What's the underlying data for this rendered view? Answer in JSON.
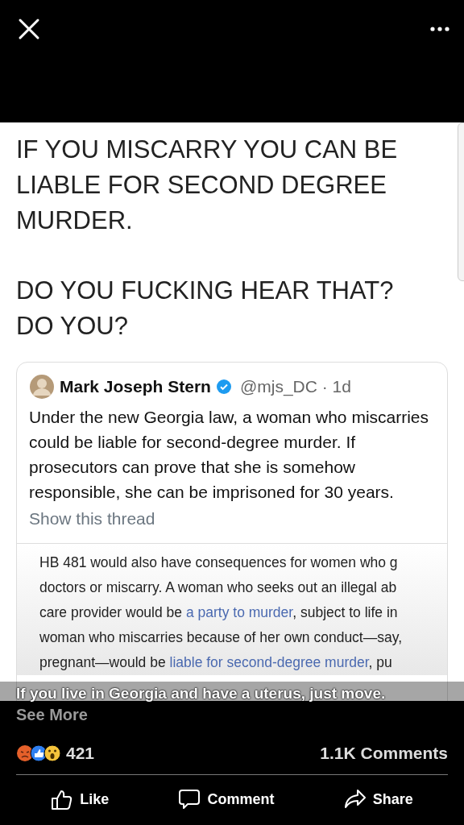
{
  "post_image": {
    "headline_lines": [
      "IF YOU MISCARRY YOU CAN BE",
      "LIABLE FOR SECOND DEGREE",
      "MURDER."
    ],
    "shout_lines": [
      "DO YOU FUCKING HEAR THAT?",
      "DO YOU?"
    ],
    "tweet": {
      "author": "Mark Joseph Stern",
      "verified": true,
      "handle": "@mjs_DC · 1d",
      "body": "Under the new Georgia law, a woman who miscarries could be liable for second-degree murder. If prosecutors can prove that she is somehow responsible, she can be imprisoned for 30 years.",
      "show_thread": "Show this thread",
      "article_lines": [
        [
          {
            "kind": "text",
            "text": "HB 481 would also have consequences for women who g"
          }
        ],
        [
          {
            "kind": "text",
            "text": "doctors or miscarry. A woman who seeks out an illegal ab"
          }
        ],
        [
          {
            "kind": "text",
            "text": "care provider would be "
          },
          {
            "kind": "link",
            "text": "a party to murder"
          },
          {
            "kind": "text",
            "text": ", subject to life in"
          }
        ],
        [
          {
            "kind": "text",
            "text": "woman who miscarries because of her own conduct—say,"
          }
        ],
        [
          {
            "kind": "text",
            "text": "pregnant—would be "
          },
          {
            "kind": "link",
            "text": "liable for second-degree murder"
          },
          {
            "kind": "text",
            "text": ", pu"
          }
        ]
      ]
    }
  },
  "caption": "If you live in Georgia and have a uterus, just move.",
  "see_more": "See More",
  "reaction_count": "421",
  "comment_count": "1.1K Comments",
  "actions": [
    {
      "kind": "like",
      "label": "Like"
    },
    {
      "kind": "comment",
      "label": "Comment"
    },
    {
      "kind": "share",
      "label": "Share"
    }
  ]
}
